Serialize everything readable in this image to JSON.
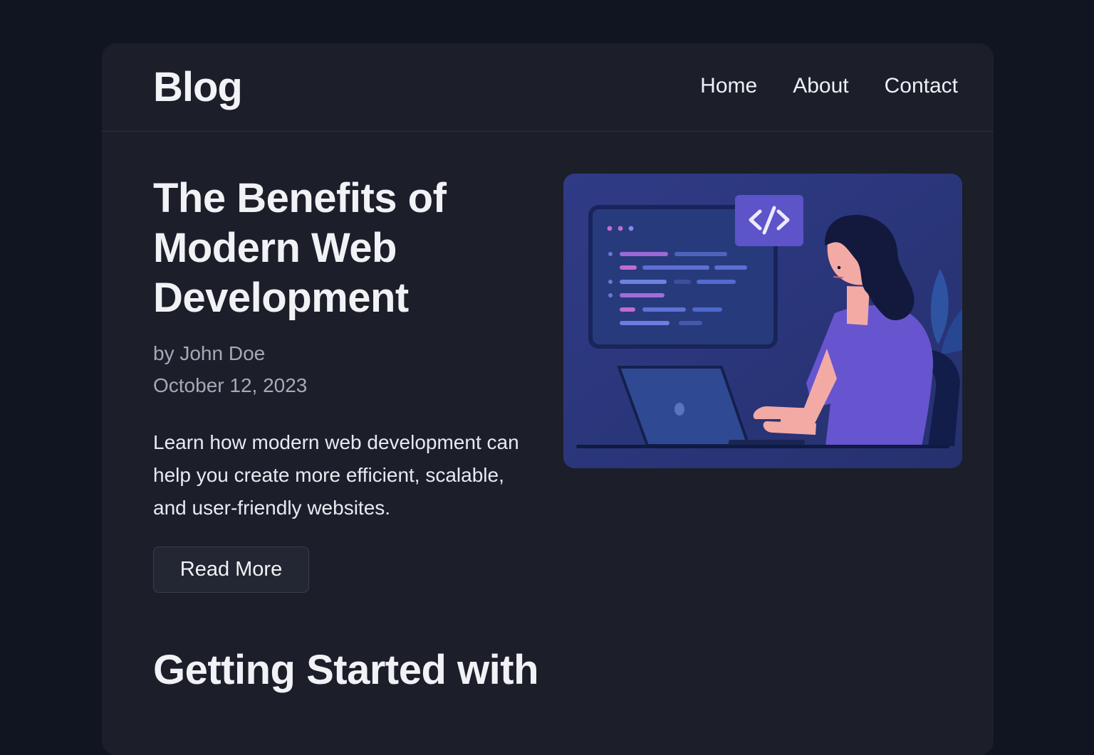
{
  "header": {
    "brand": "Blog",
    "nav": [
      {
        "label": "Home"
      },
      {
        "label": "About"
      },
      {
        "label": "Contact"
      }
    ]
  },
  "featured_post": {
    "title": "The Benefits of Modern Web Development",
    "author": "by John Doe",
    "date": "October 12, 2023",
    "excerpt": "Learn how modern web development can help you create more efficient, scalable, and user-friendly websites.",
    "read_more_label": "Read More",
    "image_icon": "code-icon",
    "image_text": "</>"
  },
  "next_post": {
    "title": "Getting Started with"
  },
  "colors": {
    "page_background": "#101521",
    "card_background": "#1c1f2a",
    "illustration_background": "#2a3579",
    "accent_purple": "#6557c8"
  }
}
